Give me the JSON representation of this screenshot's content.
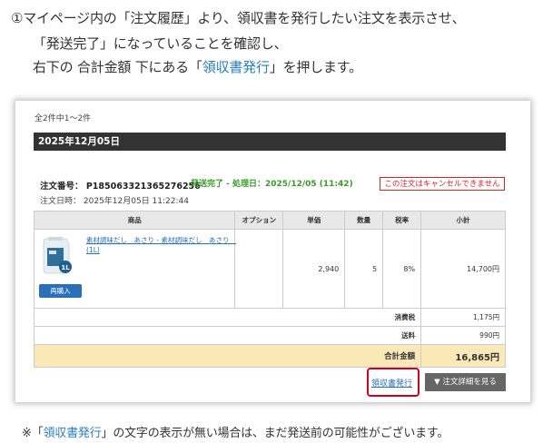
{
  "instructions": {
    "line1": "①マイページ内の「注文履歴」より、領収書を発行したい注文を表示させ、",
    "line2": "「発送完了」になっていることを確認し、",
    "line3_pre": "右下の 合計金額 下にある「",
    "line3_link": "領収書発行",
    "line3_post": "」を押します。"
  },
  "order_list": {
    "count_text": "全2件中1～2件",
    "date_header": "2025年12月05日",
    "order_number_label": "注文番号：",
    "order_number": "P185063321365276256",
    "status_text": "発送完了 - 処理日：2025/12/05 (11:42)",
    "order_date_label": "注文日時：",
    "order_date": "2025年12月05日 11:22:44",
    "cancel_note": "この注文はキャンセルできません",
    "columns": [
      "商品",
      "オプション",
      "単価",
      "数量",
      "税率",
      "小計"
    ],
    "item": {
      "name": "素材調味だし　あさり - 素材調味だし　あさり　(1L)",
      "option": "",
      "unit_price": "2,940",
      "quantity": "5",
      "tax_rate": "8%",
      "subtotal": "14,700円",
      "rebuy_label": "再購入",
      "image_label": "1L"
    },
    "consumption_tax_label": "消費税",
    "consumption_tax": "1,175円",
    "shipping_label": "送料",
    "shipping": "990円",
    "total_label": "合計金額",
    "total": "16,865円",
    "receipt_label": "領収書発行",
    "detail_label": "▼ 注文詳細を見る"
  },
  "footnote": {
    "pre": "※「",
    "link": "領収書発行",
    "post": "」の文字の表示が無い場合は、まだ発送前の可能性がございます。"
  },
  "colors": {
    "accent_blue": "#2a6fb8",
    "status_green": "#3a9a2a",
    "alert_red": "#d22222",
    "highlight_box": "#d0021b",
    "total_row_bg": "#fbe8b8"
  }
}
